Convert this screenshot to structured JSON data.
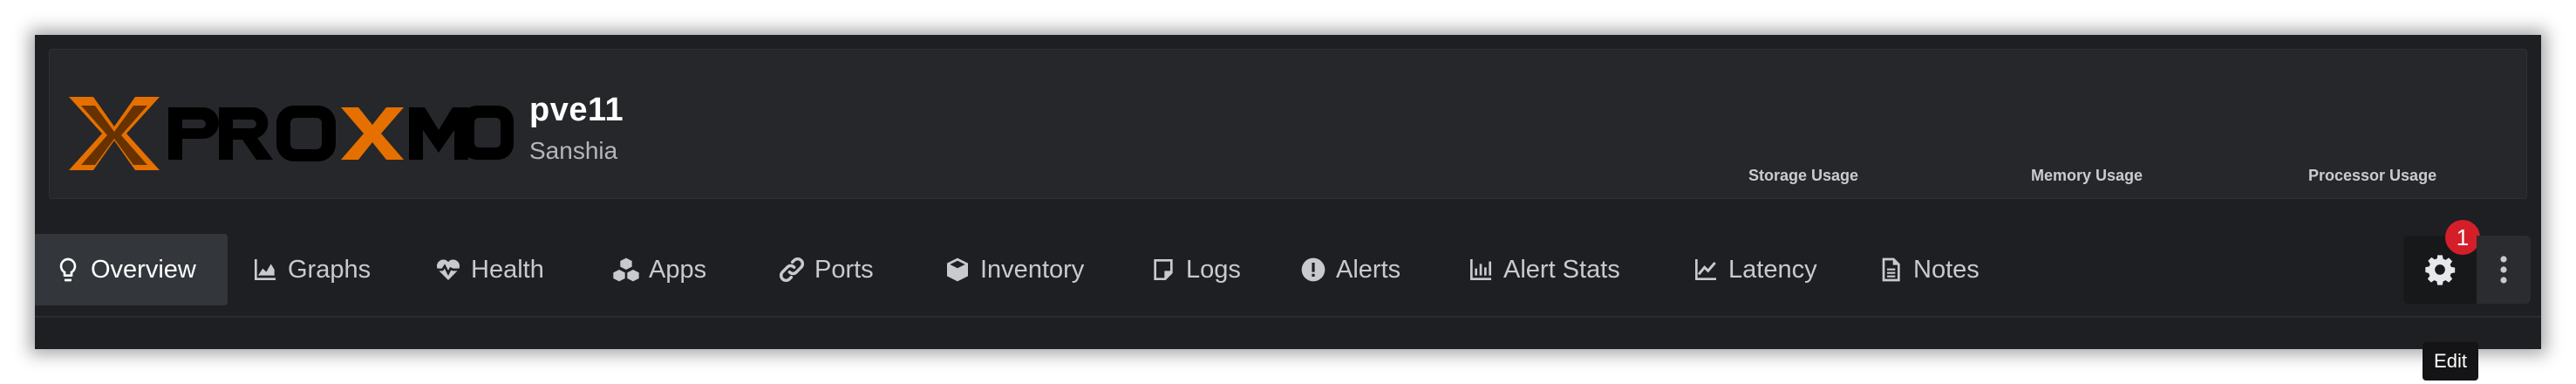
{
  "header": {
    "hostname": "pve11",
    "location": "Sanshia",
    "usage_labels": {
      "storage": "Storage Usage",
      "memory": "Memory Usage",
      "processor": "Processor Usage"
    },
    "logo_text": "PROXMOX"
  },
  "tabs": [
    {
      "label": "Overview",
      "icon": "lightbulb-icon",
      "active": true
    },
    {
      "label": "Graphs",
      "icon": "area-chart-icon"
    },
    {
      "label": "Health",
      "icon": "heartbeat-icon"
    },
    {
      "label": "Apps",
      "icon": "cubes-icon"
    },
    {
      "label": "Ports",
      "icon": "link-icon"
    },
    {
      "label": "Inventory",
      "icon": "cube-icon"
    },
    {
      "label": "Logs",
      "icon": "sticky-note-icon"
    },
    {
      "label": "Alerts",
      "icon": "exclamation-circle-icon"
    },
    {
      "label": "Alert Stats",
      "icon": "bar-chart-icon"
    },
    {
      "label": "Latency",
      "icon": "line-chart-icon"
    },
    {
      "label": "Notes",
      "icon": "file-text-icon"
    }
  ],
  "actions": {
    "edit_icon": "gear-icon",
    "edit_badge": "1",
    "edit_tooltip": "Edit",
    "more_icon": "vertical-ellipsis-icon"
  },
  "colors": {
    "background": "#1e1f22",
    "panel": "#26272b",
    "logo_orange": "#e57000",
    "badge_red": "#d41f2a",
    "tab_text": "#c8cacf"
  }
}
